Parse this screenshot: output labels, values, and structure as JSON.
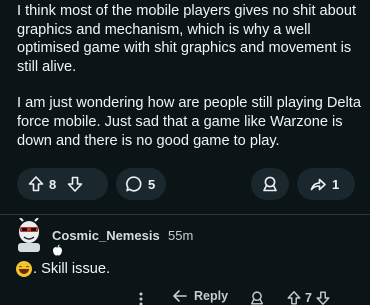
{
  "post": {
    "paragraphs": [
      "I think most of the mobile players gives no shit about graphics and mechanism, which is why a well optimised game with shit graphics and movement is still alive.",
      "I am just wondering how are people still playing Delta force mobile. Just sad that a game like Warzone is down and there is no good game to play."
    ]
  },
  "post_actions": {
    "vote_count": "8",
    "comment_count": "5",
    "share_count": "1"
  },
  "comment": {
    "username": "Cosmic_Nemesis",
    "timestamp": "55m",
    "flair_icon": "apple-icon",
    "text": ". Skill issue.",
    "actions": {
      "reply_label": "Reply",
      "vote_count": "7"
    }
  },
  "colors": {
    "background": "#0b1416",
    "pill": "#1a282d",
    "text": "#f2f4f5",
    "muted": "#c6cdd1"
  }
}
